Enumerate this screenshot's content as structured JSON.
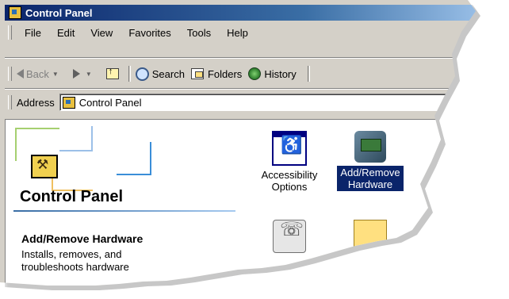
{
  "window": {
    "title": "Control Panel"
  },
  "menu": [
    "File",
    "Edit",
    "View",
    "Favorites",
    "Tools",
    "Help"
  ],
  "toolbar": {
    "back": "Back",
    "search": "Search",
    "folders": "Folders",
    "history": "History"
  },
  "address": {
    "label": "Address",
    "value": "Control Panel"
  },
  "panel": {
    "heading": "Control Panel",
    "info_title": "Add/Remove Hardware",
    "info_desc": "Installs, removes, and troubleshoots hardware"
  },
  "items": [
    {
      "label": "Accessibility Options",
      "icon": "accessibility-icon"
    },
    {
      "label": "Add/Remove Hardware",
      "icon": "hardware-icon",
      "selected": true
    },
    {
      "label": "",
      "icon": "fax-icon"
    },
    {
      "label": "",
      "icon": "folder-icon"
    }
  ]
}
